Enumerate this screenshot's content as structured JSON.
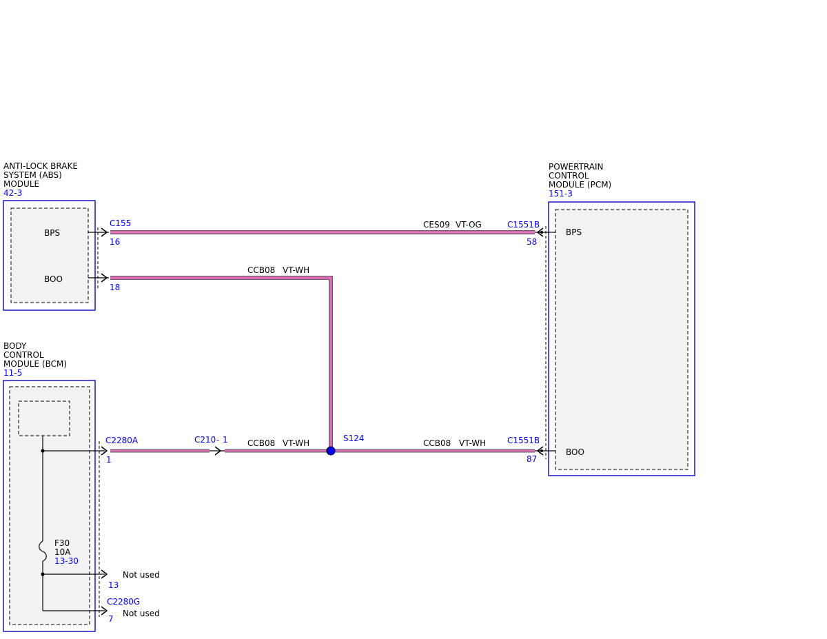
{
  "modules": {
    "abs": {
      "name_lines": [
        "ANTI-LOCK BRAKE",
        "SYSTEM (ABS)",
        "MODULE"
      ],
      "ref": "42-3",
      "pins": {
        "bps": "BPS",
        "boo": "BOO"
      }
    },
    "pcm": {
      "name_lines": [
        "POWERTRAIN",
        "CONTROL",
        "MODULE (PCM)"
      ],
      "ref": "151-3",
      "pins": {
        "bps": "BPS",
        "boo": "BOO"
      }
    },
    "bcm": {
      "name_lines": [
        "BODY",
        "CONTROL",
        "MODULE (BCM)"
      ],
      "ref": "11-5"
    }
  },
  "connectors": {
    "abs_c155": "C155",
    "abs_pin_bps": "16",
    "abs_pin_boo": "18",
    "pcm_top": "C1551B",
    "pcm_pin_bps": "58",
    "pcm_bottom": "C1551B",
    "pcm_pin_boo": "87",
    "bcm_c2280a": "C2280A",
    "bcm_pin_1": "1",
    "inline_c210": "C210",
    "inline_c210_sep": "-",
    "inline_c210_pin": "1",
    "bcm_pin_13": "13",
    "bcm_c2280g": "C2280G",
    "bcm_pin_7": "7"
  },
  "circuits": {
    "top": {
      "id": "CES09",
      "color": "VT-OG"
    },
    "abs_boo": {
      "id": "CCB08",
      "color": "VT-WH"
    },
    "bcm_left": {
      "id": "CCB08",
      "color": "VT-WH"
    },
    "bcm_right": {
      "id": "CCB08",
      "color": "VT-WH"
    }
  },
  "splice": {
    "label": "S124"
  },
  "fuse": {
    "name": "F30",
    "rating": "10A",
    "ref": "13-30"
  },
  "unused": {
    "pin13": "Not used",
    "pin7": "Not used"
  },
  "colors": {
    "wire": "#e46fb8",
    "wire_edge": "#6a5a6a",
    "ref_text": "#0000ff",
    "module_border": "#2424c8",
    "splice_dot": "#0000ff"
  }
}
